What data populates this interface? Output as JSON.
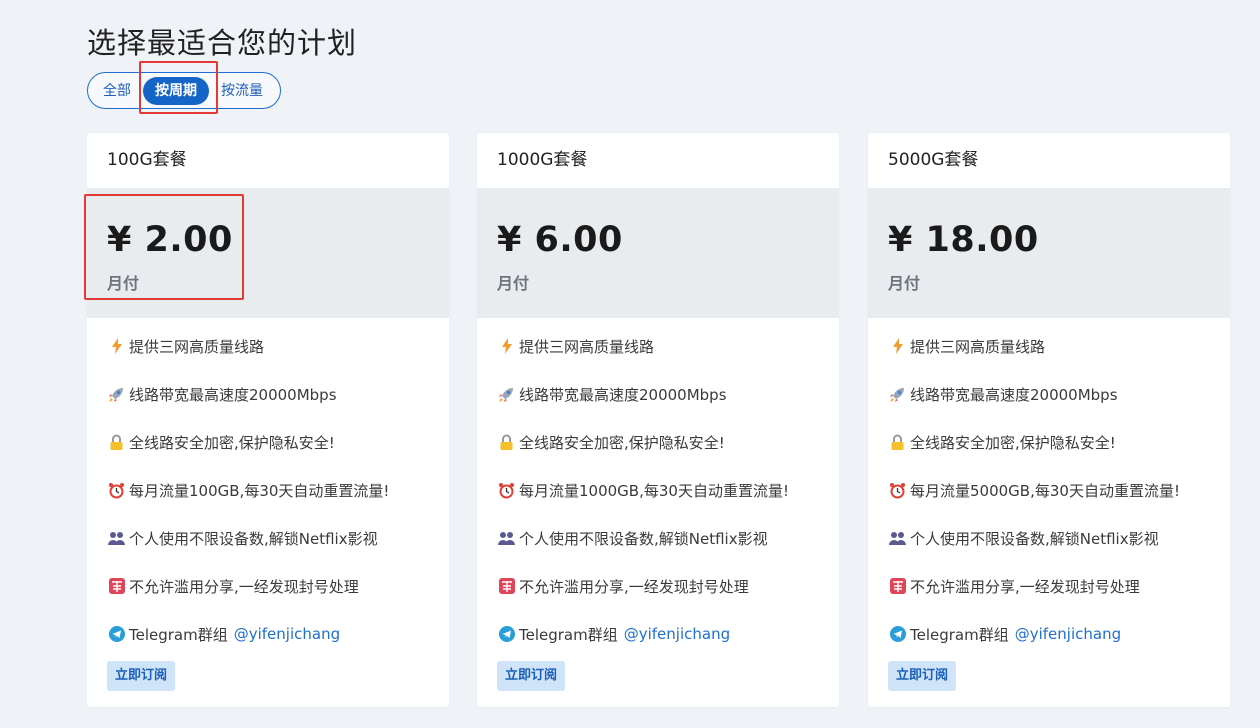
{
  "page_title": "选择最适合您的计划",
  "filters": [
    {
      "label": "全部",
      "active": false
    },
    {
      "label": "按周期",
      "active": true
    },
    {
      "label": "按流量",
      "active": false
    }
  ],
  "plans": [
    {
      "name": "100G套餐",
      "price": "¥ 2.00",
      "period": "月付",
      "features": [
        {
          "icon": "lightning-icon",
          "text": "提供三网高质量线路"
        },
        {
          "icon": "rocket-icon",
          "text": "线路带宽最高速度20000Mbps"
        },
        {
          "icon": "lock-icon",
          "text": "全线路安全加密,保护隐私安全!"
        },
        {
          "icon": "alarm-clock-icon",
          "text": "每月流量100GB,每30天自动重置流量!"
        },
        {
          "icon": "users-icon",
          "text": "个人使用不限设备数,解锁Netflix影视"
        },
        {
          "icon": "prohibited-icon",
          "text": "不允许滥用分享,一经发现封号处理"
        }
      ],
      "telegram_text": "Telegram群组",
      "telegram_link": "@yifenjichang",
      "button": "立即订阅"
    },
    {
      "name": "1000G套餐",
      "price": "¥ 6.00",
      "period": "月付",
      "features": [
        {
          "icon": "lightning-icon",
          "text": "提供三网高质量线路"
        },
        {
          "icon": "rocket-icon",
          "text": "线路带宽最高速度20000Mbps"
        },
        {
          "icon": "lock-icon",
          "text": "全线路安全加密,保护隐私安全!"
        },
        {
          "icon": "alarm-clock-icon",
          "text": "每月流量1000GB,每30天自动重置流量!"
        },
        {
          "icon": "users-icon",
          "text": "个人使用不限设备数,解锁Netflix影视"
        },
        {
          "icon": "prohibited-icon",
          "text": "不允许滥用分享,一经发现封号处理"
        }
      ],
      "telegram_text": "Telegram群组",
      "telegram_link": "@yifenjichang",
      "button": "立即订阅"
    },
    {
      "name": "5000G套餐",
      "price": "¥ 18.00",
      "period": "月付",
      "features": [
        {
          "icon": "lightning-icon",
          "text": "提供三网高质量线路"
        },
        {
          "icon": "rocket-icon",
          "text": "线路带宽最高速度20000Mbps"
        },
        {
          "icon": "lock-icon",
          "text": "全线路安全加密,保护隐私安全!"
        },
        {
          "icon": "alarm-clock-icon",
          "text": "每月流量5000GB,每30天自动重置流量!"
        },
        {
          "icon": "users-icon",
          "text": "个人使用不限设备数,解锁Netflix影视"
        },
        {
          "icon": "prohibited-icon",
          "text": "不允许滥用分享,一经发现封号处理"
        }
      ],
      "telegram_text": "Telegram群组",
      "telegram_link": "@yifenjichang",
      "button": "立即订阅"
    }
  ],
  "colors": {
    "background": "#eff2f7",
    "accent": "#1565c8",
    "price_block": "#e9ecef",
    "highlight_box": "#e53935",
    "button_bg": "#cfe3f9"
  }
}
